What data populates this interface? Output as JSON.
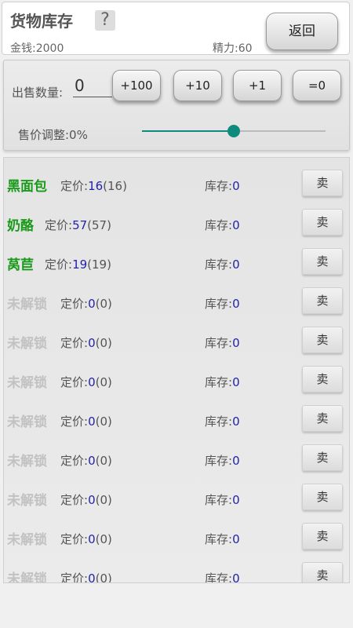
{
  "header": {
    "title": "货物库存",
    "help_icon": "question-mark-icon",
    "money": "金钱:2000",
    "energy": "精力:60",
    "back_label": "返回"
  },
  "controls": {
    "quantity_label": "出售数量:",
    "quantity_value": "0",
    "buttons": [
      "+100",
      "+10",
      "+1",
      "=0"
    ],
    "price_adjust_label": "售价调整:0%",
    "slider_level": 0.5,
    "accent_color": "#0e8a7e"
  },
  "items": [
    {
      "name": "黑面包",
      "locked": false,
      "price_label": "定价:",
      "price": "16",
      "base": "16",
      "stock_label": "库存:",
      "stock": "0",
      "sell_label": "卖"
    },
    {
      "name": "奶酪",
      "locked": false,
      "price_label": "定价:",
      "price": "57",
      "base": "57",
      "stock_label": "库存:",
      "stock": "0",
      "sell_label": "卖"
    },
    {
      "name": "莴苣",
      "locked": false,
      "price_label": "定价:",
      "price": "19",
      "base": "19",
      "stock_label": "库存:",
      "stock": "0",
      "sell_label": "卖"
    },
    {
      "name": "未解锁",
      "locked": true,
      "price_label": "定价:",
      "price": "0",
      "base": "0",
      "stock_label": "库存:",
      "stock": "0",
      "sell_label": "卖"
    },
    {
      "name": "未解锁",
      "locked": true,
      "price_label": "定价:",
      "price": "0",
      "base": "0",
      "stock_label": "库存:",
      "stock": "0",
      "sell_label": "卖"
    },
    {
      "name": "未解锁",
      "locked": true,
      "price_label": "定价:",
      "price": "0",
      "base": "0",
      "stock_label": "库存:",
      "stock": "0",
      "sell_label": "卖"
    },
    {
      "name": "未解锁",
      "locked": true,
      "price_label": "定价:",
      "price": "0",
      "base": "0",
      "stock_label": "库存:",
      "stock": "0",
      "sell_label": "卖"
    },
    {
      "name": "未解锁",
      "locked": true,
      "price_label": "定价:",
      "price": "0",
      "base": "0",
      "stock_label": "库存:",
      "stock": "0",
      "sell_label": "卖"
    },
    {
      "name": "未解锁",
      "locked": true,
      "price_label": "定价:",
      "price": "0",
      "base": "0",
      "stock_label": "库存:",
      "stock": "0",
      "sell_label": "卖"
    },
    {
      "name": "未解锁",
      "locked": true,
      "price_label": "定价:",
      "price": "0",
      "base": "0",
      "stock_label": "库存:",
      "stock": "0",
      "sell_label": "卖"
    },
    {
      "name": "未解锁",
      "locked": true,
      "price_label": "定价:",
      "price": "0",
      "base": "0",
      "stock_label": "库存:",
      "stock": "0",
      "sell_label": "卖"
    }
  ]
}
